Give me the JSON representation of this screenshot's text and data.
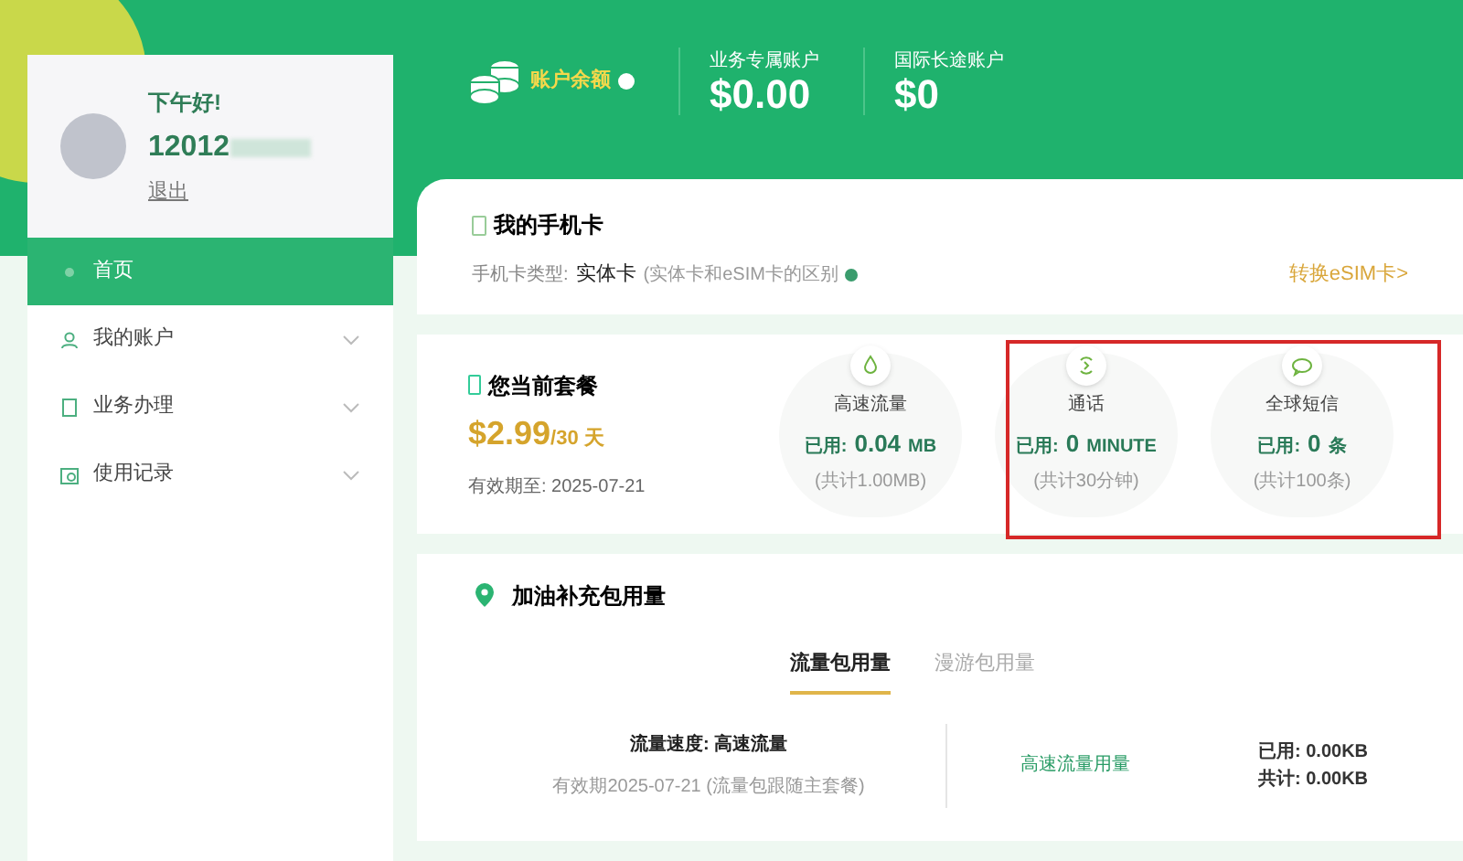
{
  "profile": {
    "greeting": "下午好!",
    "account": "12012",
    "logout": "退出"
  },
  "menu": [
    {
      "label": "首页",
      "selected": true,
      "expandable": false
    },
    {
      "label": "我的账户",
      "selected": false,
      "expandable": true
    },
    {
      "label": "业务办理",
      "selected": false,
      "expandable": true
    },
    {
      "label": "使用记录",
      "selected": false,
      "expandable": true
    }
  ],
  "balances": [
    {
      "label": "账户余额",
      "kind": "main"
    },
    {
      "label": "业务专属账户",
      "value": "$0.00",
      "kind": "amount"
    },
    {
      "label": "国际长途账户",
      "value": "$0",
      "kind": "amount"
    }
  ],
  "sim_card": {
    "title": "我的手机卡",
    "type_label": "手机卡类型:",
    "type_value": "实体卡",
    "note": "(实体卡和eSIM卡的区别",
    "switch_link": "转换eSIM卡>"
  },
  "plan": {
    "title": "您当前套餐",
    "price": "$2.99",
    "period": "/30 天",
    "expiry": "有效期至: 2025-07-21",
    "usages": [
      {
        "name": "高速流量",
        "used_label": "已用:",
        "used": "0.04",
        "unit": "MB",
        "total": "(共计1.00MB)"
      },
      {
        "name": "通话",
        "used_label": "已用:",
        "used": "0",
        "unit": "MINUTE",
        "total": "(共计30分钟)"
      },
      {
        "name": "全球短信",
        "used_label": "已用:",
        "used": "0",
        "unit": "条",
        "total": "(共计100条)"
      }
    ]
  },
  "addon": {
    "title": "加油补充包用量",
    "tabs": [
      {
        "label": "流量包用量",
        "selected": true
      },
      {
        "label": "漫游包用量",
        "selected": false
      }
    ],
    "speed": "流量速度: 高速流量",
    "validity": "有效期2025-07-21 (流量包跟随主套餐)",
    "usage_name": "高速流量用量",
    "used": "已用: 0.00KB",
    "total": "共计: 0.00KB"
  }
}
